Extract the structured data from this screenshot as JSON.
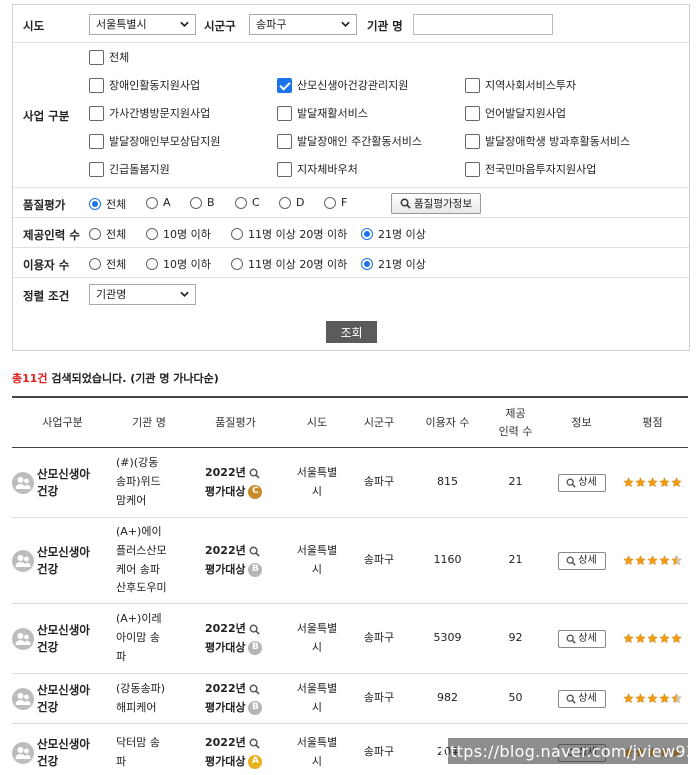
{
  "filters": {
    "sido": {
      "label": "시도",
      "value": "서울특별시"
    },
    "sigungu": {
      "label": "시군구",
      "value": "송파구"
    },
    "org_name": {
      "label": "기관 명",
      "value": ""
    },
    "business": {
      "label": "사업 구분",
      "all": {
        "label": "전체",
        "checked": false
      },
      "options": [
        {
          "label": "장애인활동지원사업",
          "checked": false
        },
        {
          "label": "산모신생아건강관리지원",
          "checked": true
        },
        {
          "label": "지역사회서비스투자",
          "checked": false
        },
        {
          "label": "가사간병방문지원사업",
          "checked": false
        },
        {
          "label": "발달재활서비스",
          "checked": false
        },
        {
          "label": "언어발달지원사업",
          "checked": false
        },
        {
          "label": "발달장애인부모상담지원",
          "checked": false
        },
        {
          "label": "발달장애인 주간활동서비스",
          "checked": false
        },
        {
          "label": "발달장애학생 방과후활동서비스",
          "checked": false
        },
        {
          "label": "긴급돌봄지원",
          "checked": false
        },
        {
          "label": "지자체바우처",
          "checked": false
        },
        {
          "label": "전국민마음투자지원사업",
          "checked": false
        }
      ]
    },
    "quality": {
      "label": "품질평가",
      "options": [
        "전체",
        "A",
        "B",
        "C",
        "D",
        "F"
      ],
      "selected": "전체",
      "info_button": "품질평가정보"
    },
    "staff": {
      "label": "제공인력 수",
      "options": [
        "전체",
        "10명 이하",
        "11명 이상 20명 이하",
        "21명 이상"
      ],
      "selected": "21명 이상"
    },
    "users": {
      "label": "이용자 수",
      "options": [
        "전체",
        "10명 이하",
        "11명 이상 20명 이하",
        "21명 이상"
      ],
      "selected": "21명 이상"
    },
    "sort": {
      "label": "정렬 조건",
      "value": "기관명"
    },
    "search_button": "조회"
  },
  "result": {
    "count_text": "총11건",
    "suffix_text": " 검색되었습니다. (기관 명 가나다순)"
  },
  "table": {
    "headers": [
      "사업구분",
      "기관 명",
      "품질평가",
      "시도",
      "시군구",
      "이용자 수",
      "제공\n인력 수",
      "정보",
      "평점"
    ],
    "rows": [
      {
        "biz": "산모신생아\n건강",
        "name": "(#)(강동\n송파)위드\n맘케어",
        "year": "2022년",
        "qual_text": "평가대상",
        "grade": "C",
        "grade_color": "#c98a2a",
        "sido": "서울특별\n시",
        "sigungu": "송파구",
        "users": "815",
        "staff": "21",
        "detail": "상세",
        "rating": 5
      },
      {
        "biz": "산모신생아\n건강",
        "name": "(A+)에이\n플러스산모\n케어 송파\n산후도우미",
        "year": "2022년",
        "qual_text": "평가대상",
        "grade": "B",
        "grade_color": "#b5b5b5",
        "sido": "서울특별\n시",
        "sigungu": "송파구",
        "users": "1160",
        "staff": "21",
        "detail": "상세",
        "rating": 4.5
      },
      {
        "biz": "산모신생아\n건강",
        "name": "(A+)이레\n아이맘 송\n파",
        "year": "2022년",
        "qual_text": "평가대상",
        "grade": "B",
        "grade_color": "#b5b5b5",
        "sido": "서울특별\n시",
        "sigungu": "송파구",
        "users": "5309",
        "staff": "92",
        "detail": "상세",
        "rating": 5
      },
      {
        "biz": "산모신생아\n건강",
        "name": "(강동송파)\n해피케어",
        "year": "2022년",
        "qual_text": "평가대상",
        "grade": "B",
        "grade_color": "#b5b5b5",
        "sido": "서울특별\n시",
        "sigungu": "송파구",
        "users": "982",
        "staff": "50",
        "detail": "상세",
        "rating": 4.5
      },
      {
        "biz": "산모신생아\n건강",
        "name": "닥터맘 송\n파",
        "year": "2022년",
        "qual_text": "평가대상",
        "grade": "A",
        "grade_color": "#e8b21c",
        "sido": "서울특별\n시",
        "sigungu": "송파구",
        "users": "204",
        "staff": "",
        "detail": "상세",
        "rating": 5
      }
    ]
  },
  "watermark": "https://blog.naver.com/jview93",
  "colors": {
    "accent": "#1a73e8",
    "count_red": "#e02020",
    "star": "#f39c12"
  }
}
